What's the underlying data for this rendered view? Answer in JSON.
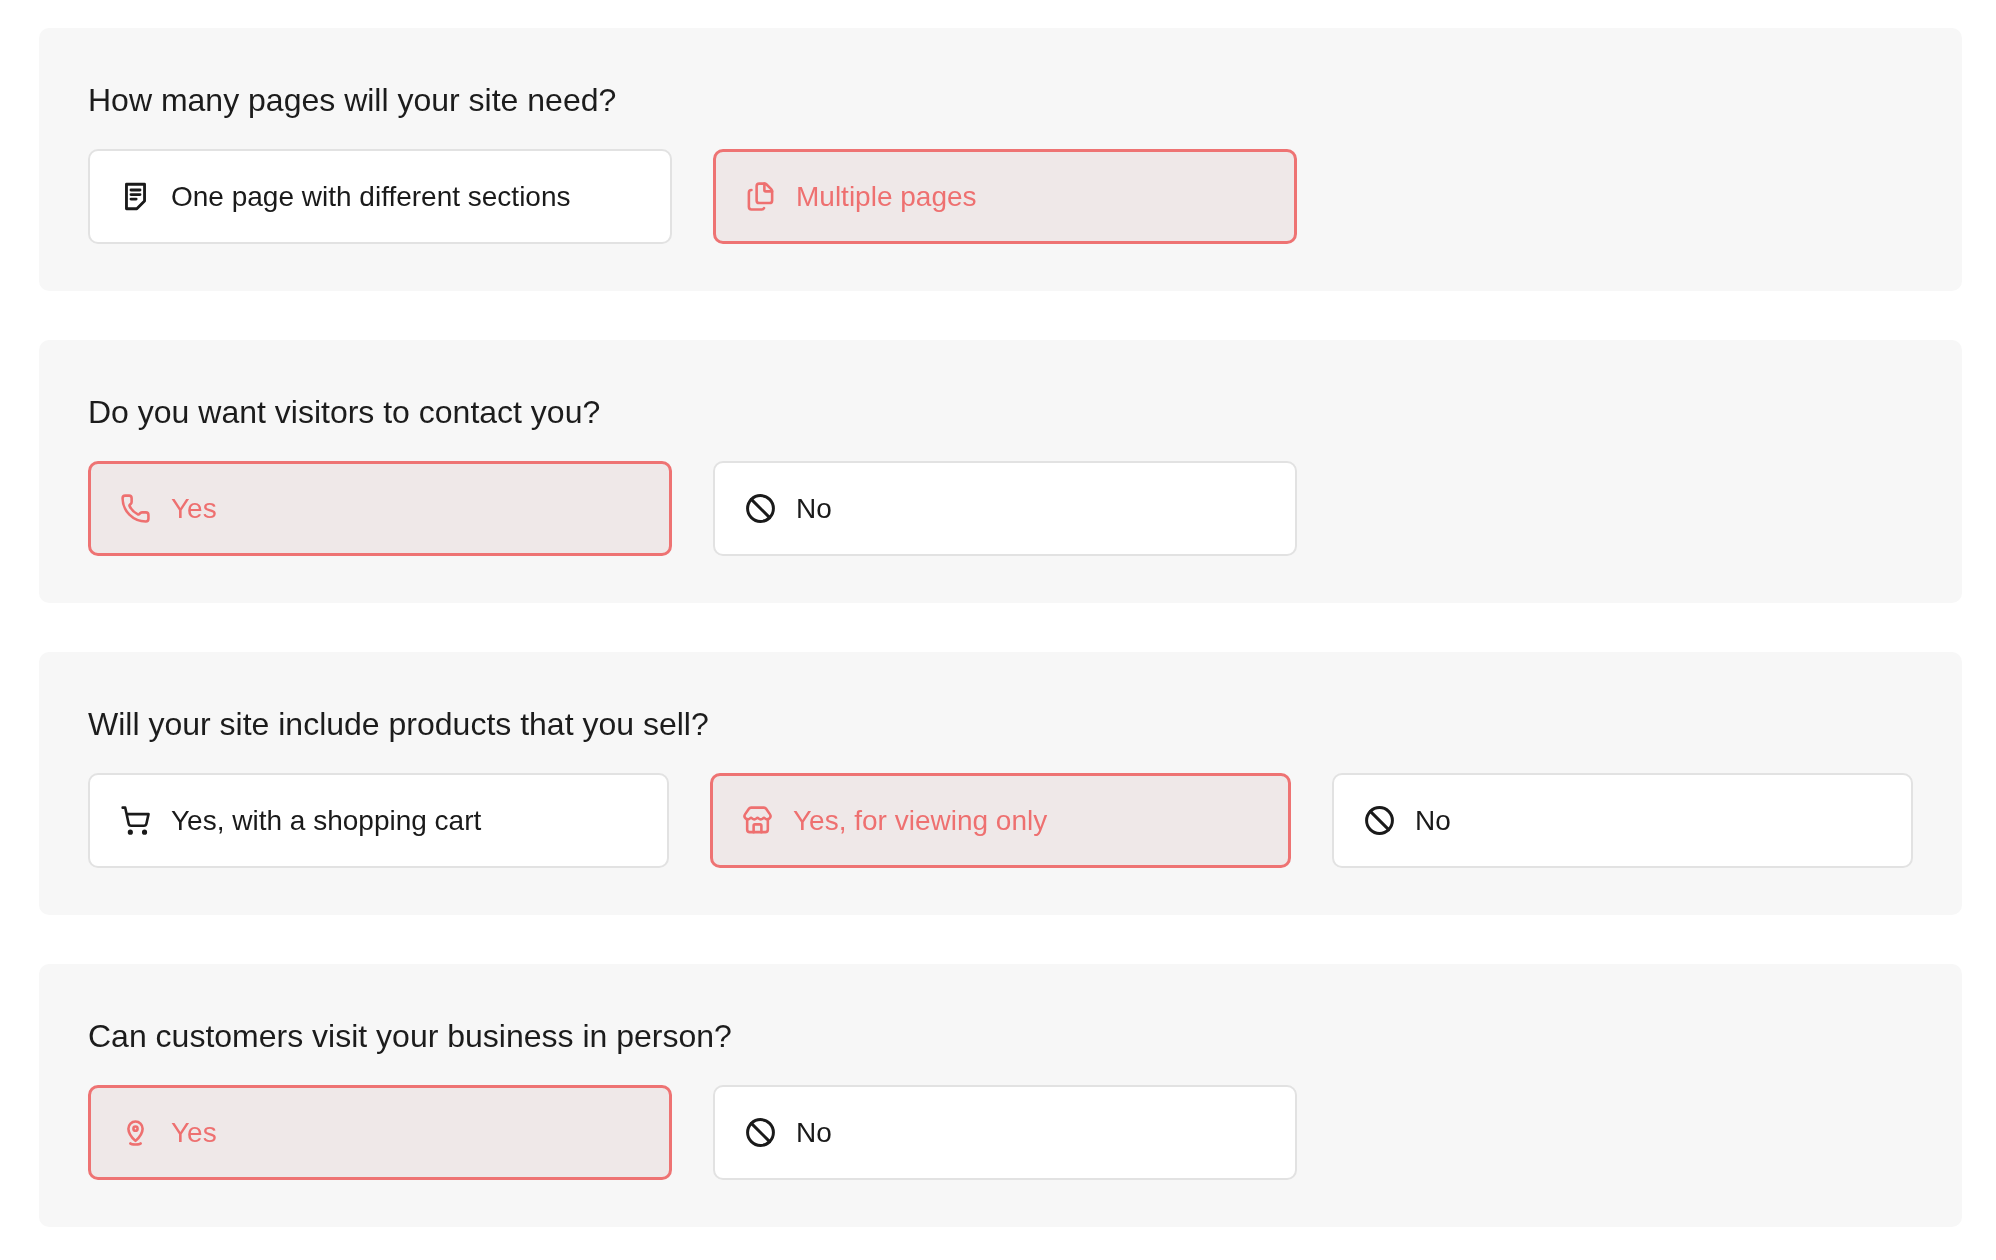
{
  "questions": [
    {
      "title": "How many pages will your site need?",
      "options": [
        {
          "label": "One page with different sections",
          "kind": "document",
          "selected": false
        },
        {
          "label": "Multiple pages",
          "kind": "pages",
          "selected": true
        }
      ]
    },
    {
      "title": "Do you want visitors to contact you?",
      "options": [
        {
          "label": "Yes",
          "kind": "phone",
          "selected": true
        },
        {
          "label": "No",
          "kind": "none",
          "selected": false
        }
      ]
    },
    {
      "title": "Will your site include products that you sell?",
      "options": [
        {
          "label": "Yes, with a shopping cart",
          "kind": "cart",
          "selected": false
        },
        {
          "label": "Yes, for viewing only",
          "kind": "store",
          "selected": true
        },
        {
          "label": "No",
          "kind": "none",
          "selected": false
        }
      ]
    },
    {
      "title": "Can customers visit your business in person?",
      "options": [
        {
          "label": "Yes",
          "kind": "location",
          "selected": true
        },
        {
          "label": "No",
          "kind": "none",
          "selected": false
        }
      ]
    }
  ]
}
